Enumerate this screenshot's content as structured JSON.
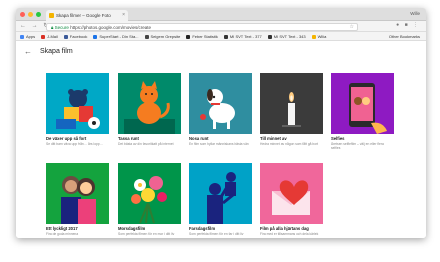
{
  "browser": {
    "tab_title": "Skapa filmer – Google Foto",
    "tab_close": "×",
    "profile": "Wille",
    "nav": "← → ↻",
    "secure_label": "Secure",
    "url": "https://photos.google.com/movies/create",
    "star": "☆",
    "ext_icons": "● ■ ⋮"
  },
  "bookmarks": {
    "items": [
      {
        "label": "Apps",
        "color": "#4285f4"
      },
      {
        "label": "J-Mail",
        "color": "#d93025"
      },
      {
        "label": "Facebook",
        "color": "#3b5998"
      },
      {
        "label": "SuperStart - Din Sta...",
        "color": "#1a73e8"
      },
      {
        "label": "Seigem Grepsite",
        "color": "#444444"
      },
      {
        "label": "Feber Statistik",
        "color": "#222222"
      },
      {
        "label": "MI SVT Text - 377",
        "color": "#333333"
      },
      {
        "label": "MI SVT Text - 343",
        "color": "#333333"
      },
      {
        "label": "Wilia",
        "color": "#f4b400"
      }
    ],
    "other": "Other Bookmarks"
  },
  "page": {
    "back_icon": "←",
    "title": "Skapa film"
  },
  "cards": [
    {
      "title": "De växer upp så fort",
      "subtitle": "Se ditt barn växa upp från… års lopp…",
      "bg": "#00a8c6"
    },
    {
      "title": "Tassa runt",
      "subtitle": "Det bästa av din favoritkatt på internet",
      "bg": "#008a6a"
    },
    {
      "title": "Nosa runt",
      "subtitle": "En film som hyllar människans bästa vän",
      "bg": "#2f8ea0"
    },
    {
      "title": "Till minnet av",
      "subtitle": "Hedra minnet av någon som fått gå bort",
      "bg": "#3b3b3b"
    },
    {
      "title": "Selfies",
      "subtitle": "Åretsen selfiefilm – välj en eller flera selfies",
      "bg": "#8e1ac2"
    },
    {
      "title": "Ett lyckligt 2017",
      "subtitle": "Fira de goda minnena",
      "bg": "#14a33e"
    },
    {
      "title": "Morsdagsfilm",
      "subtitle": "Som perfekta filmen för en mor i ditt liv",
      "bg": "#00954a"
    },
    {
      "title": "Farsdagsfilm",
      "subtitle": "Som perfekta filmen för en far i ditt liv",
      "bg": "#00a2c7"
    },
    {
      "title": "Film på alla hjärtans dag",
      "subtitle": "Fira med er tillsammans och dela kärlek",
      "bg": "#f0679b"
    }
  ],
  "colors": {
    "close": "#ff5f57",
    "minimize": "#febc2e",
    "maximize": "#28c840"
  }
}
